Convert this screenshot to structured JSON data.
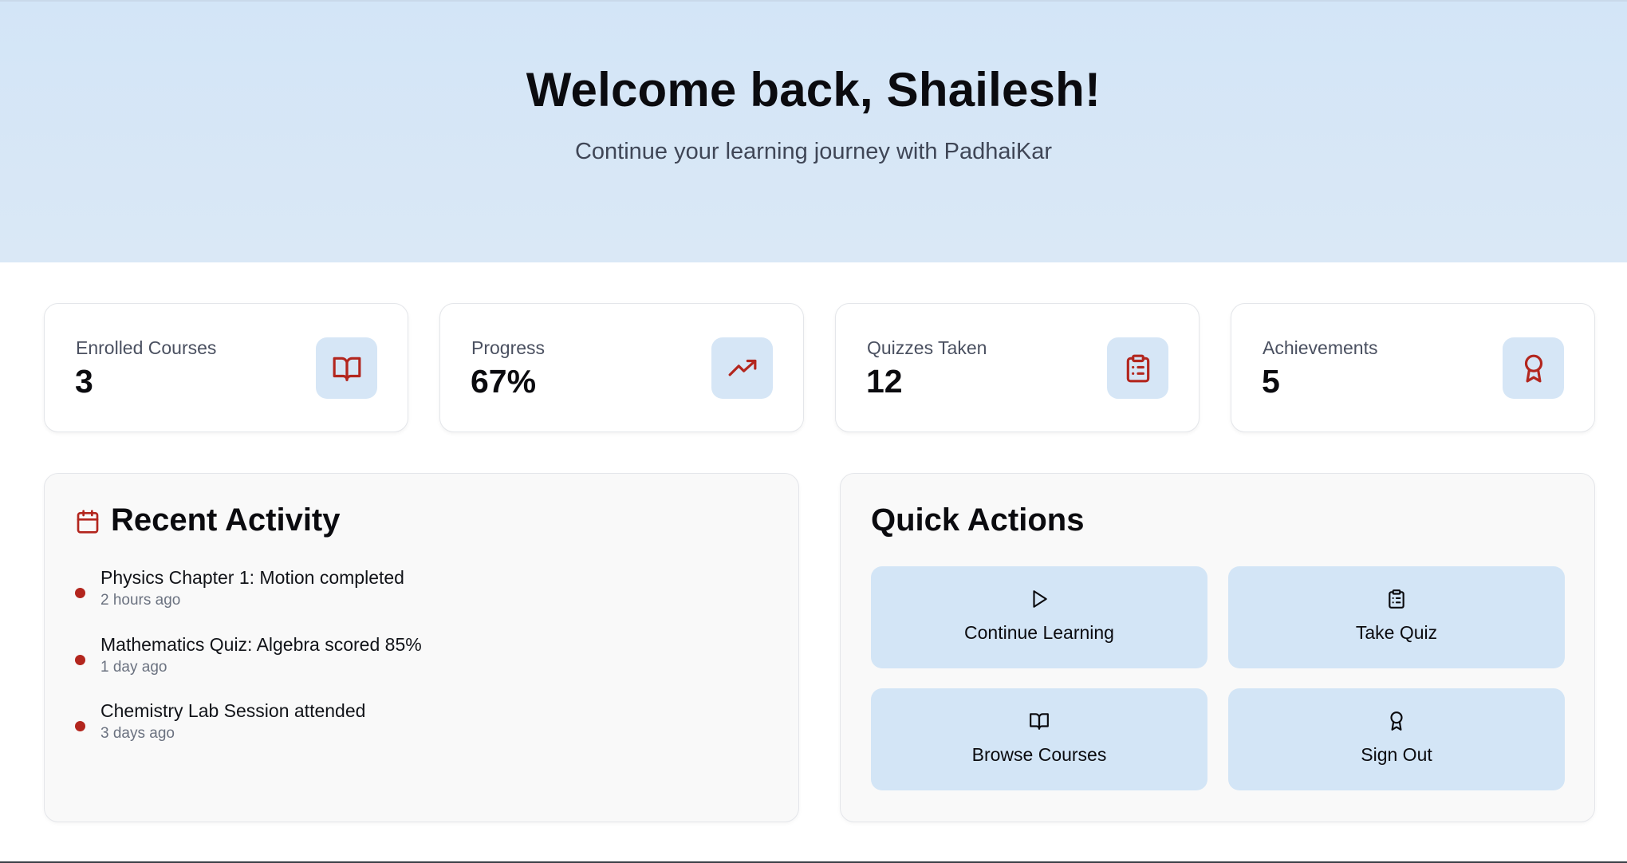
{
  "hero": {
    "title": "Welcome back, Shailesh!",
    "subtitle": "Continue your learning journey with PadhaiKar"
  },
  "stats": [
    {
      "label": "Enrolled Courses",
      "value": "3",
      "icon": "book-open-icon"
    },
    {
      "label": "Progress",
      "value": "67%",
      "icon": "trending-up-icon"
    },
    {
      "label": "Quizzes Taken",
      "value": "12",
      "icon": "clipboard-list-icon"
    },
    {
      "label": "Achievements",
      "value": "5",
      "icon": "award-icon"
    }
  ],
  "recent_activity": {
    "title": "Recent Activity",
    "icon": "calendar-icon",
    "items": [
      {
        "text": "Physics Chapter 1: Motion completed",
        "time": "2 hours ago"
      },
      {
        "text": "Mathematics Quiz: Algebra scored 85%",
        "time": "1 day ago"
      },
      {
        "text": "Chemistry Lab Session attended",
        "time": "3 days ago"
      }
    ]
  },
  "quick_actions": {
    "title": "Quick Actions",
    "buttons": [
      {
        "label": "Continue Learning",
        "icon": "play-icon"
      },
      {
        "label": "Take Quiz",
        "icon": "clipboard-list-icon"
      },
      {
        "label": "Browse Courses",
        "icon": "book-open-icon"
      },
      {
        "label": "Sign Out",
        "icon": "award-icon"
      }
    ]
  },
  "colors": {
    "hero_background": "#d6e7f7",
    "icon_tile_background": "#d6e6f6",
    "accent_red": "#b3261e",
    "action_button_background": "#d3e5f6"
  }
}
